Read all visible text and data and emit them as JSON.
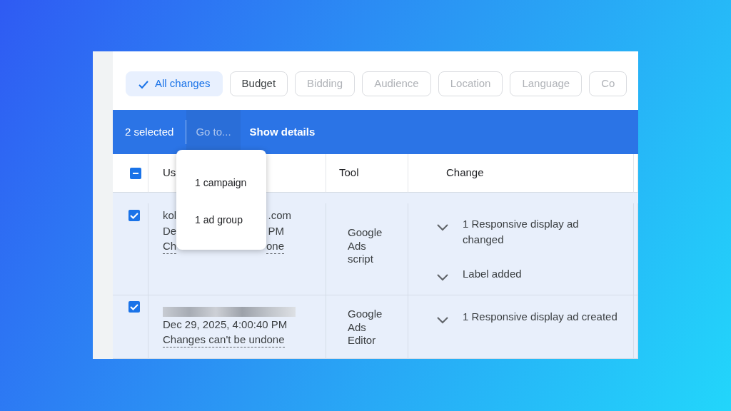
{
  "filters": [
    {
      "label": "All changes",
      "selected": true,
      "disabled": false
    },
    {
      "label": "Budget",
      "selected": false,
      "disabled": false
    },
    {
      "label": "Bidding",
      "selected": false,
      "disabled": true
    },
    {
      "label": "Audience",
      "selected": false,
      "disabled": true
    },
    {
      "label": "Location",
      "selected": false,
      "disabled": true
    },
    {
      "label": "Language",
      "selected": false,
      "disabled": true
    },
    {
      "label": "Co",
      "selected": false,
      "disabled": true
    }
  ],
  "selection_bar": {
    "count": "2 selected",
    "actions": [
      {
        "label": "Go to...",
        "expanded": true
      },
      {
        "label": "Show details",
        "expanded": false
      }
    ]
  },
  "menu": {
    "items": [
      "1 campaign",
      "1 ad group"
    ]
  },
  "table": {
    "select_all_indeterminate": true,
    "columns": [
      "Us",
      "Tool",
      "Change"
    ],
    "rows": [
      {
        "selected": true,
        "email": [
          "kol",
          ".com"
        ],
        "email_redacted": false,
        "time": [
          "De",
          "PM"
        ],
        "note": [
          "Ch",
          "one"
        ],
        "tool": "Google Ads script",
        "changes": [
          {
            "text": "1 Responsive display ad changed",
            "expanded": false
          },
          {
            "text": "Label added",
            "expanded": false
          }
        ]
      },
      {
        "selected": true,
        "email": [],
        "email_redacted": true,
        "time": [
          "Dec 29, 2025, 4:00:40 PM"
        ],
        "note": [
          "Changes can't be undone"
        ],
        "tool": "Google Ads Editor",
        "changes": [
          {
            "text": "1 Responsive display ad created",
            "expanded": false
          }
        ]
      }
    ]
  }
}
